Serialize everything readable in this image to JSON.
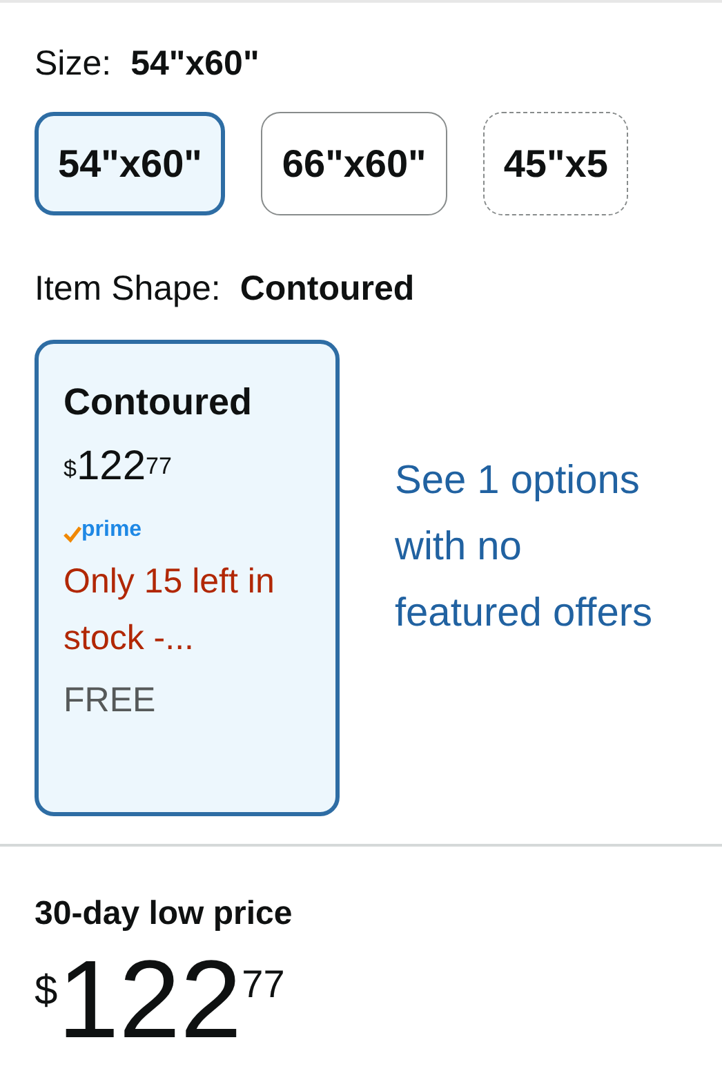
{
  "size": {
    "label": "Size:",
    "value": "54\"x60\"",
    "options": [
      {
        "label": "54\"x60\"",
        "selected": true,
        "available": true
      },
      {
        "label": "66\"x60\"",
        "selected": false,
        "available": true
      },
      {
        "label": "45\"x5",
        "selected": false,
        "available": false
      }
    ]
  },
  "item_shape": {
    "label": "Item Shape:",
    "value": "Contoured",
    "options": [
      {
        "title": "Contoured",
        "selected": true,
        "price": {
          "symbol": "$",
          "whole": "122",
          "fraction": "77"
        },
        "prime": "prime",
        "stock": "Only 15 left in stock -...",
        "delivery": "FREE"
      }
    ],
    "more_link": "See 1 options with no featured offers"
  },
  "low_price": {
    "label": "30-day low price",
    "price": {
      "symbol": "$",
      "whole": "122",
      "fraction": "77"
    }
  }
}
